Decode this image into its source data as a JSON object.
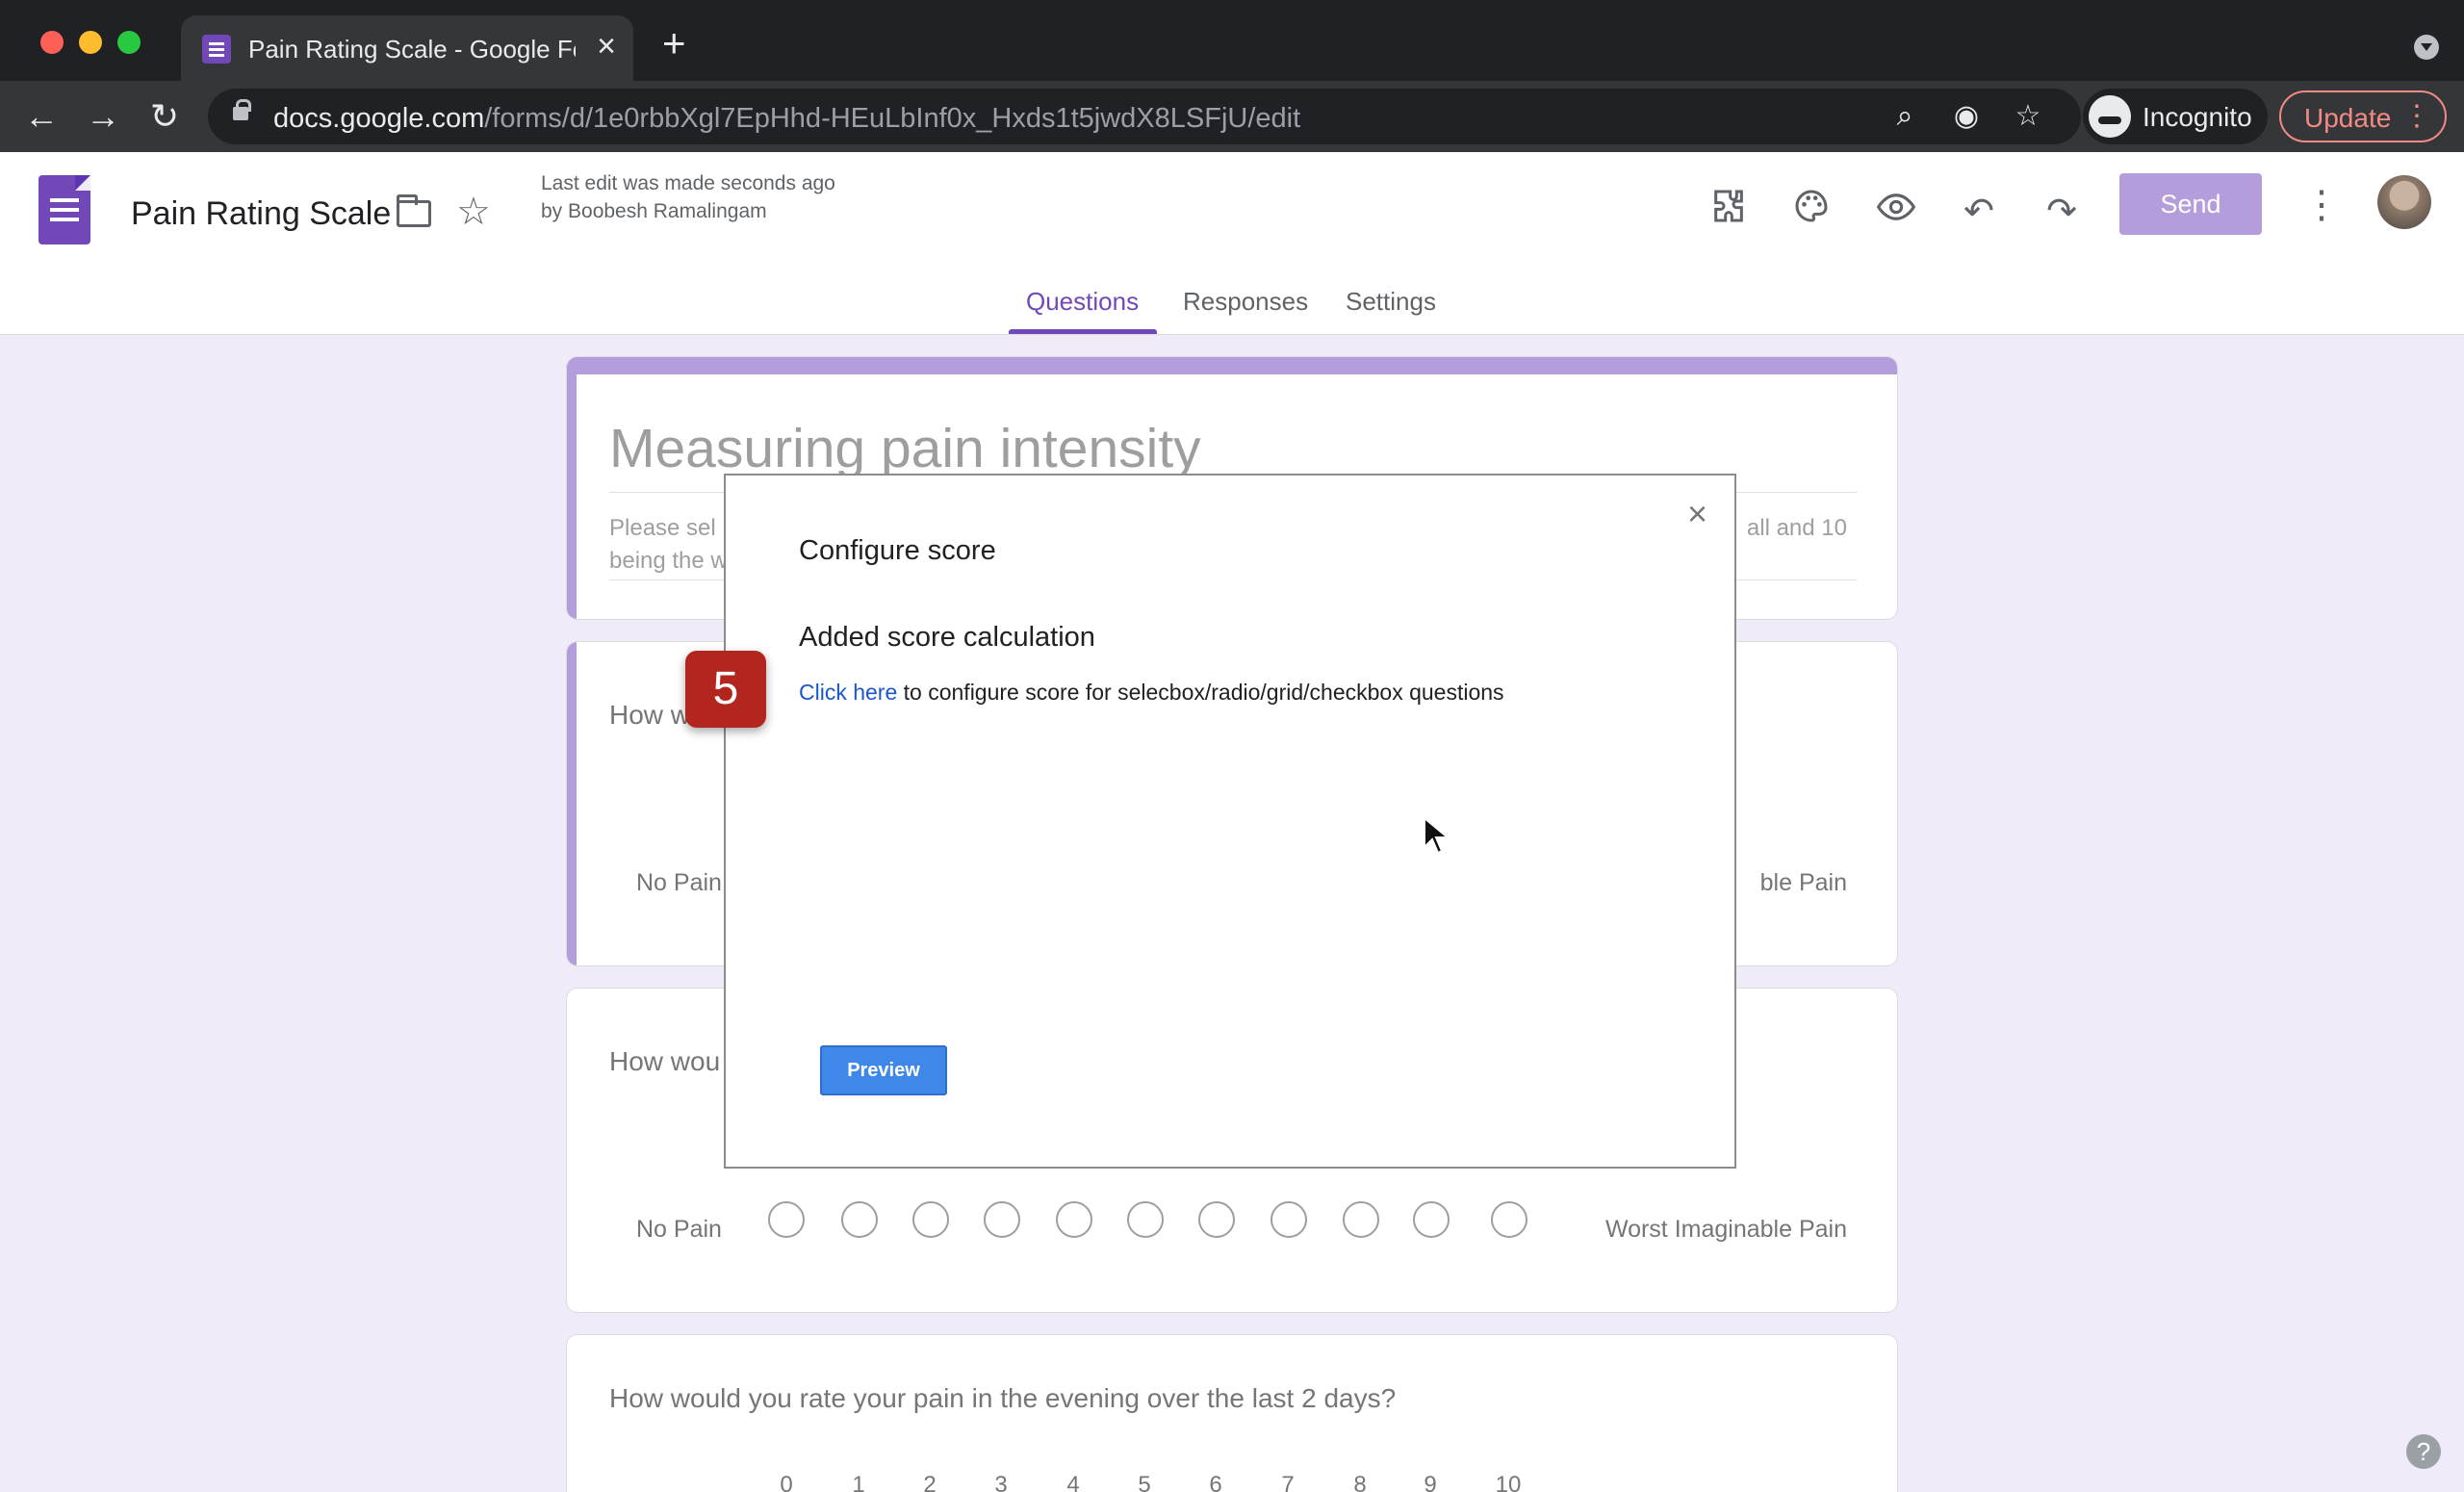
{
  "browser": {
    "tab_title": "Pain Rating Scale - Google Forms",
    "url_host": "docs.google.com",
    "url_path": "/forms/d/1e0rbbXgl7EpHhd-HEuLbInf0x_Hxds1t5jwdX8LSFjU/edit",
    "profile_label": "Incognito",
    "update_label": "Update"
  },
  "header": {
    "doc_title": "Pain Rating Scale",
    "last_edit": "Last edit was made seconds ago by Boobesh Ramalingam",
    "send_label": "Send",
    "tabs": [
      {
        "label": "Questions",
        "active": true
      },
      {
        "label": "Responses",
        "active": false
      },
      {
        "label": "Settings",
        "active": false
      }
    ]
  },
  "form": {
    "title": "Measuring pain intensity",
    "description_left_line1": "Please sel",
    "description_left_line2": "being the w",
    "description_right": "all and 10",
    "questions": [
      {
        "text_visible": "How w",
        "low_label": "No Pain",
        "high_label_visible": "ble Pain"
      },
      {
        "text_visible": "How wou",
        "low_label": "No Pain",
        "high_label": "Worst Imaginable Pain"
      },
      {
        "text": "How would you rate your pain in the evening over the last 2 days?",
        "scale": [
          "0",
          "1",
          "2",
          "3",
          "4",
          "5",
          "6",
          "7",
          "8",
          "9",
          "10"
        ]
      }
    ]
  },
  "dialog": {
    "title": "Configure score",
    "heading": "Added score calculation",
    "link_text": "Click here",
    "body_text": " to configure score for selecbox/radio/grid/checkbox questions",
    "preview_label": "Preview",
    "close_glyph": "×"
  },
  "overlay": {
    "step_number": "5"
  },
  "icons": {
    "close": "×",
    "plus": "+",
    "back": "←",
    "forward": "→",
    "reload": "↻",
    "search": "⌕",
    "star": "☆",
    "eye": "◉",
    "undo": "↶",
    "redo": "↷",
    "more": "⋮",
    "help": "?"
  },
  "colors": {
    "accent": "#7248b9",
    "send_disabled": "#b39ddb",
    "step_badge": "#b3261e",
    "link": "#1a57cc",
    "preview_button": "#3f87e8"
  }
}
